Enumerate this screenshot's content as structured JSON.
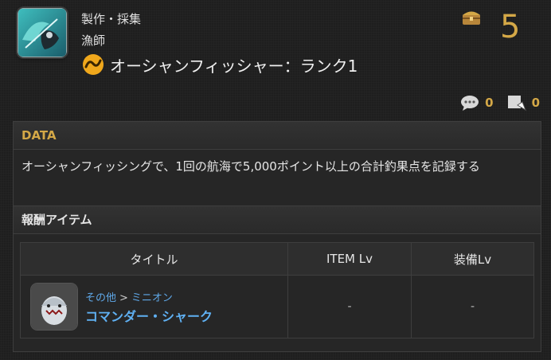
{
  "header": {
    "achievement_icon": "fish-caught-icon",
    "category_main": "製作・採集",
    "category_sub": "漁師",
    "title_icon": "ocean-fishing-icon",
    "title": "オーシャンフィッシャー：ランク1",
    "points_icon": "treasure-chest-icon",
    "points": "5"
  },
  "stats": {
    "comment_icon": "comment-icon",
    "comment_count": "0",
    "share_icon": "share-icon",
    "share_count": "0"
  },
  "data_section": {
    "heading": "DATA",
    "description": "オーシャンフィッシングで、1回の航海で5,000ポイント以上の合計釣果点を記録する"
  },
  "reward_section": {
    "heading": "報酬アイテム",
    "columns": [
      "タイトル",
      "ITEM Lv",
      "装備Lv"
    ],
    "rows": [
      {
        "icon": "shark-minion-icon",
        "category": "その他",
        "subcategory": "ミニオン",
        "name": "コマンダー・シャーク",
        "item_lv": "-",
        "equip_lv": "-"
      }
    ]
  },
  "colors": {
    "accent_gold": "#d4a847",
    "link_blue": "#5fb0f2",
    "background": "#1e1e1e"
  }
}
